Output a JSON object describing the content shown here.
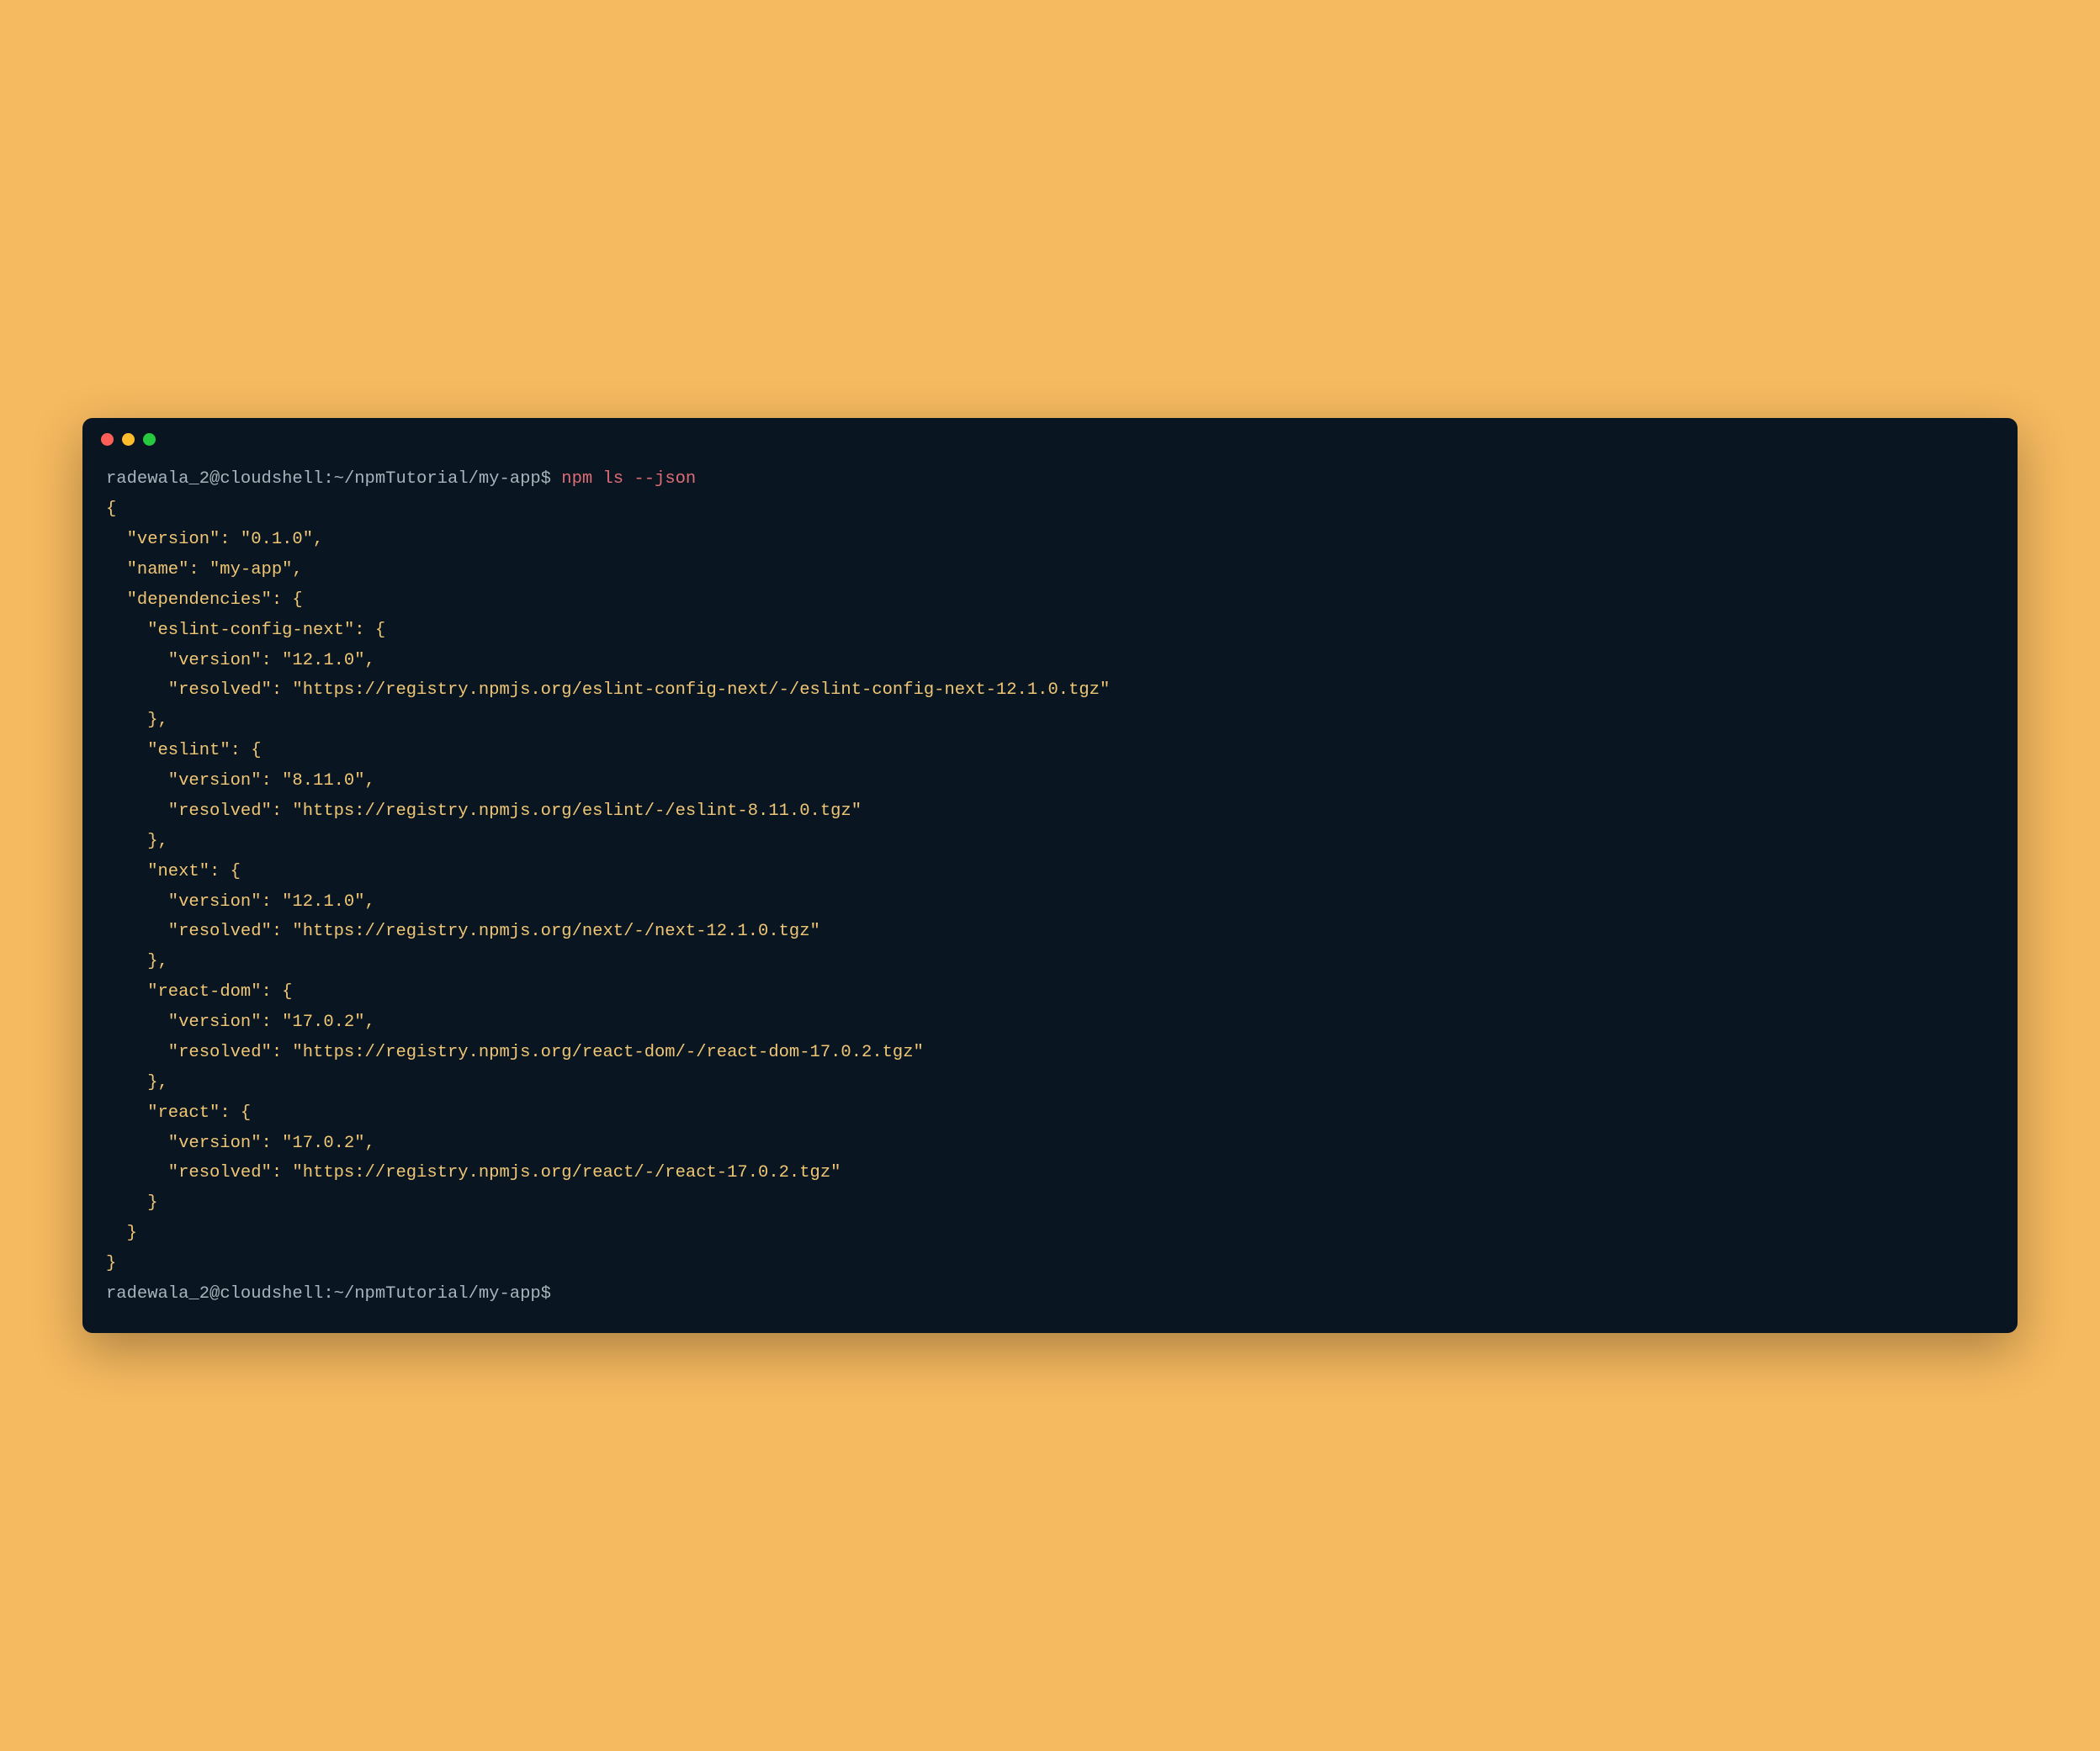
{
  "titlebar": {
    "buttons": [
      "close",
      "minimize",
      "maximize"
    ]
  },
  "prompt1": {
    "user_host_path": "radewala_2@cloudshell:~/npmTutorial/my-app$ ",
    "command": "npm ls --json"
  },
  "output": {
    "line_open_brace": "{",
    "line_version": "\"version\": \"0.1.0\",",
    "line_name": "\"name\": \"my-app\",",
    "line_deps_open": "\"dependencies\": {",
    "dep_eslint_config_next_open": "\"eslint-config-next\": {",
    "dep_eslint_config_next_version": "\"version\": \"12.1.0\",",
    "dep_eslint_config_next_resolved": "\"resolved\": \"https://registry.npmjs.org/eslint-config-next/-/eslint-config-next-12.1.0.tgz\"",
    "close_comma": "},",
    "dep_eslint_open": "\"eslint\": {",
    "dep_eslint_version": "\"version\": \"8.11.0\",",
    "dep_eslint_resolved": "\"resolved\": \"https://registry.npmjs.org/eslint/-/eslint-8.11.0.tgz\"",
    "dep_next_open": "\"next\": {",
    "dep_next_version": "\"version\": \"12.1.0\",",
    "dep_next_resolved": "\"resolved\": \"https://registry.npmjs.org/next/-/next-12.1.0.tgz\"",
    "dep_react_dom_open": "\"react-dom\": {",
    "dep_react_dom_version": "\"version\": \"17.0.2\",",
    "dep_react_dom_resolved": "\"resolved\": \"https://registry.npmjs.org/react-dom/-/react-dom-17.0.2.tgz\"",
    "dep_react_open": "\"react\": {",
    "dep_react_version": "\"version\": \"17.0.2\",",
    "dep_react_resolved": "\"resolved\": \"https://registry.npmjs.org/react/-/react-17.0.2.tgz\"",
    "close_brace": "}",
    "line_deps_close": "}",
    "line_close_brace": "}"
  },
  "prompt2": {
    "user_host_path": "radewala_2@cloudshell:~/npmTutorial/my-app$ "
  }
}
